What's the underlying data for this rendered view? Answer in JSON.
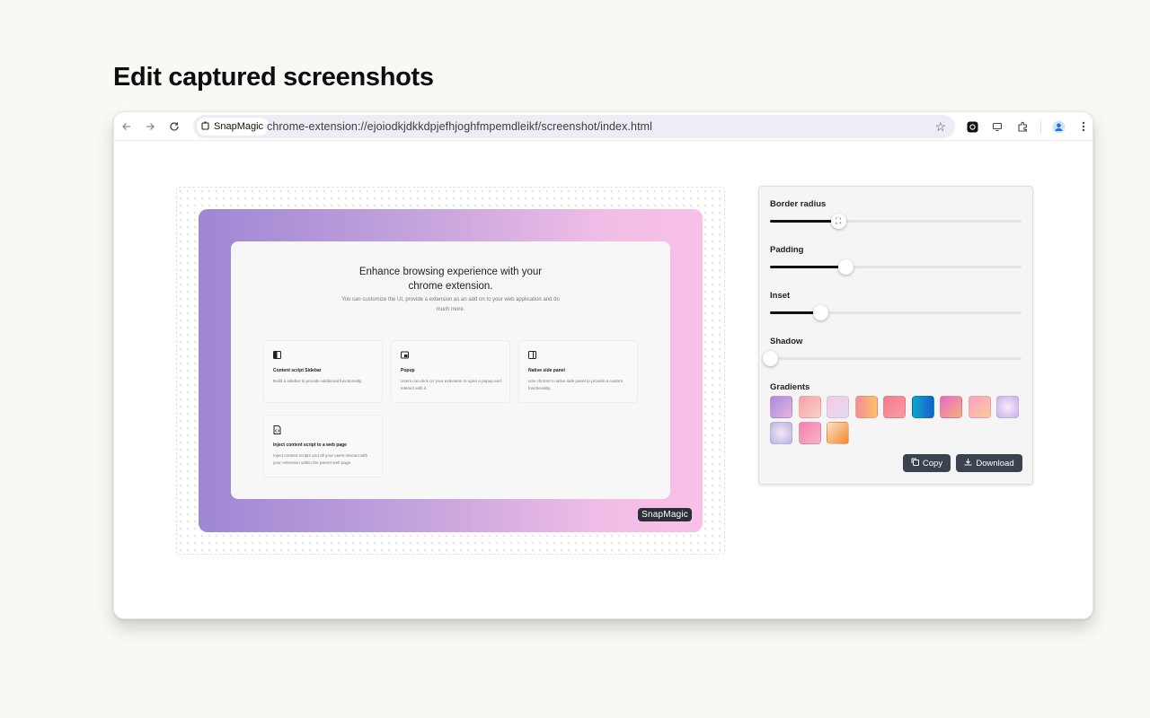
{
  "page": {
    "heading": "Edit captured screenshots"
  },
  "browser": {
    "site_chip": "SnapMagic",
    "url": "chrome-extension://ejoiodkjdkkdpjefhjoghfmpemdleikf/screenshot/index.html",
    "icons": [
      "back-icon",
      "forward-icon",
      "reload-icon",
      "bookmark-star-icon",
      "snapmagic-extension-icon",
      "cast-icon",
      "extensions-puzzle-icon",
      "profile-avatar-icon",
      "more-menu-icon"
    ]
  },
  "preview": {
    "title_line1": "Enhance browsing experience with your",
    "title_line2": "chrome extension.",
    "subtitle": "You can customize the UI, provide a extension as an add on to your web application and do much more.",
    "features": [
      {
        "title": "Content script Sidebar",
        "desc": "Build a sidebar to provide additional functionality.",
        "icon": "sidebar-icon"
      },
      {
        "title": "Popup",
        "desc": "Users can click on your extension to open a popup and interact with it.",
        "icon": "popup-window-icon"
      },
      {
        "title": "Native side panel",
        "desc": "Use chrome's native side panel to provide a custom functionality.",
        "icon": "side-panel-icon"
      },
      {
        "title": "Inject content script to a web page",
        "desc": "Inject content scripts and all your users interact with your extension within the parent web page.",
        "icon": "script-file-icon"
      }
    ],
    "badge": "SnapMagic",
    "gradient": [
      "#9e87d4",
      "#f8c0e8"
    ]
  },
  "controls": {
    "border_radius": {
      "label": "Border radius",
      "value": 0.27
    },
    "padding": {
      "label": "Padding",
      "value": 0.3
    },
    "inset": {
      "label": "Inset",
      "value": 0.2
    },
    "shadow": {
      "label": "Shadow",
      "value": 0.0
    },
    "gradients_label": "Gradients",
    "gradient_swatches": [
      "linear-gradient(135deg,#a98bd8,#e7b4e6)",
      "linear-gradient(135deg,#f7a1a5,#fcd0c8)",
      "linear-gradient(135deg,#f5c9e0,#e6d9f6)",
      "linear-gradient(90deg,#f58ba0,#fec165)",
      "linear-gradient(135deg,#f77b8a,#f89aa3)",
      "linear-gradient(90deg,#0aa9c9,#1a5dcf)",
      "linear-gradient(135deg,#e46ac8,#f8b078)",
      "linear-gradient(135deg,#f9a0c8,#fccb95)",
      "radial-gradient(circle,#fbeaf7,#c8b1ec)",
      "radial-gradient(circle,#f6e6f4,#b8b4e4)",
      "linear-gradient(135deg,#f57fb1,#f9b4c4)",
      "linear-gradient(135deg,#fce1c4,#f3892e)"
    ],
    "copy_label": "Copy",
    "download_label": "Download"
  }
}
